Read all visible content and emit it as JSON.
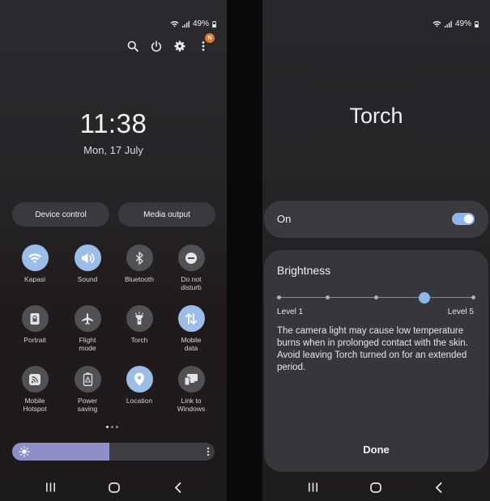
{
  "left": {
    "status": {
      "battery": "49%"
    },
    "clock": {
      "time": "11:38",
      "date": "Mon, 17 July"
    },
    "notification_badge": "N",
    "device_control": "Device control",
    "media_output": "Media output",
    "tiles": [
      {
        "label": "Kapasi",
        "icon": "wifi-icon",
        "on": true
      },
      {
        "label": "Sound",
        "icon": "sound-icon",
        "on": true
      },
      {
        "label": "Bluetooth",
        "icon": "bluetooth-icon",
        "on": false
      },
      {
        "label": "Do not\ndisturb",
        "icon": "do-not-disturb-icon",
        "on": false
      },
      {
        "label": "Portrait",
        "icon": "portrait-lock-icon",
        "on": false
      },
      {
        "label": "Flight\nmode",
        "icon": "airplane-icon",
        "on": false
      },
      {
        "label": "Torch",
        "icon": "torch-icon",
        "on": false
      },
      {
        "label": "Mobile\ndata",
        "icon": "mobile-data-icon",
        "on": true
      },
      {
        "label": "Mobile\nHotspot",
        "icon": "hotspot-icon",
        "on": false
      },
      {
        "label": "Power\nsaving",
        "icon": "power-saving-icon",
        "on": false
      },
      {
        "label": "Location",
        "icon": "location-icon",
        "on": true
      },
      {
        "label": "Link to\nWindows",
        "icon": "link-to-windows-icon",
        "on": false
      }
    ],
    "brightness_level": 0.48,
    "colors": {
      "tile_on": "#9dbde9",
      "tile_off": "#505055",
      "brightness_fill": "#8f8fc8"
    }
  },
  "right": {
    "status": {
      "battery": "49%"
    },
    "title": "Torch",
    "on_label": "On",
    "toggle_on": true,
    "brightness_title": "Brightness",
    "level_min": "Level 1",
    "level_max": "Level 5",
    "brightness_value": 4,
    "brightness_steps": 5,
    "warning": "The camera light may cause low temperature burns when in prolonged contact with the skin. Avoid leaving Torch turned on for an extended period.",
    "done": "Done",
    "colors": {
      "accent": "#8fb6e8"
    }
  }
}
